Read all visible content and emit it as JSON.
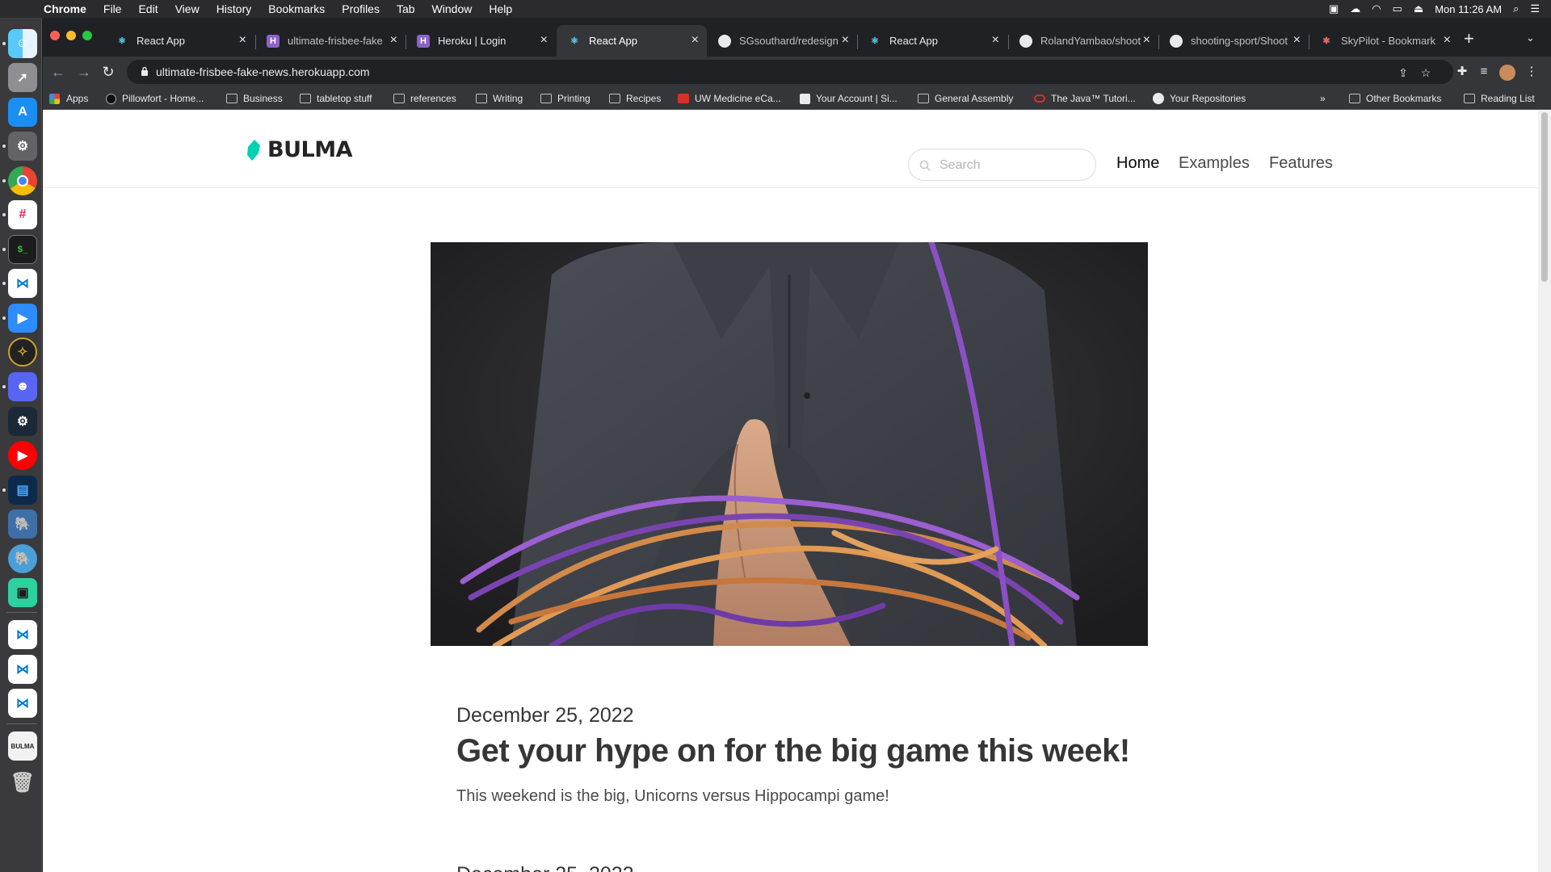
{
  "menubar": {
    "app": "Chrome",
    "items": [
      "File",
      "Edit",
      "View",
      "History",
      "Bookmarks",
      "Profiles",
      "Tab",
      "Window",
      "Help"
    ],
    "clock": "Mon 11:26 AM"
  },
  "tabs": [
    {
      "title": "React App",
      "icon": "react-icon"
    },
    {
      "title": "ultimate-frisbee-fake",
      "icon": "heroku-icon"
    },
    {
      "title": "Heroku | Login",
      "icon": "heroku-icon"
    },
    {
      "title": "React App",
      "icon": "react-icon",
      "active": true
    },
    {
      "title": "SGsouthard/redesign",
      "icon": "github-icon"
    },
    {
      "title": "React App",
      "icon": "react-icon"
    },
    {
      "title": "RolandYambao/shoot",
      "icon": "github-icon"
    },
    {
      "title": "shooting-sport/Shoot",
      "icon": "github-icon"
    },
    {
      "title": "SkyPilot - Bookmark",
      "icon": "skypilot-icon"
    }
  ],
  "toolbar": {
    "url": "ultimate-frisbee-fake-news.herokuapp.com"
  },
  "bookmarks": {
    "apps": "Apps",
    "items": [
      "Pillowfort - Home...",
      "Business",
      "tabletop stuff",
      "references",
      "Writing",
      "Printing",
      "Recipes",
      "UW Medicine eCa...",
      "Your Account | Si...",
      "General Assembly",
      "The Java™ Tutori...",
      "Your Repositories"
    ],
    "overflow": "»",
    "other": "Other Bookmarks",
    "reading_list": "Reading List"
  },
  "site": {
    "logo": "BULMA",
    "search_placeholder": "Search",
    "nav": [
      "Home",
      "Examples",
      "Features"
    ],
    "brand_color": "#00d1b2"
  },
  "post": {
    "date": "December 25, 2022",
    "headline": "Get your hype on for the big game this week!",
    "summary": "This weekend is the big, Unicorns versus Hippocampi game!"
  },
  "next_post": {
    "date": "December 25, 2022"
  }
}
